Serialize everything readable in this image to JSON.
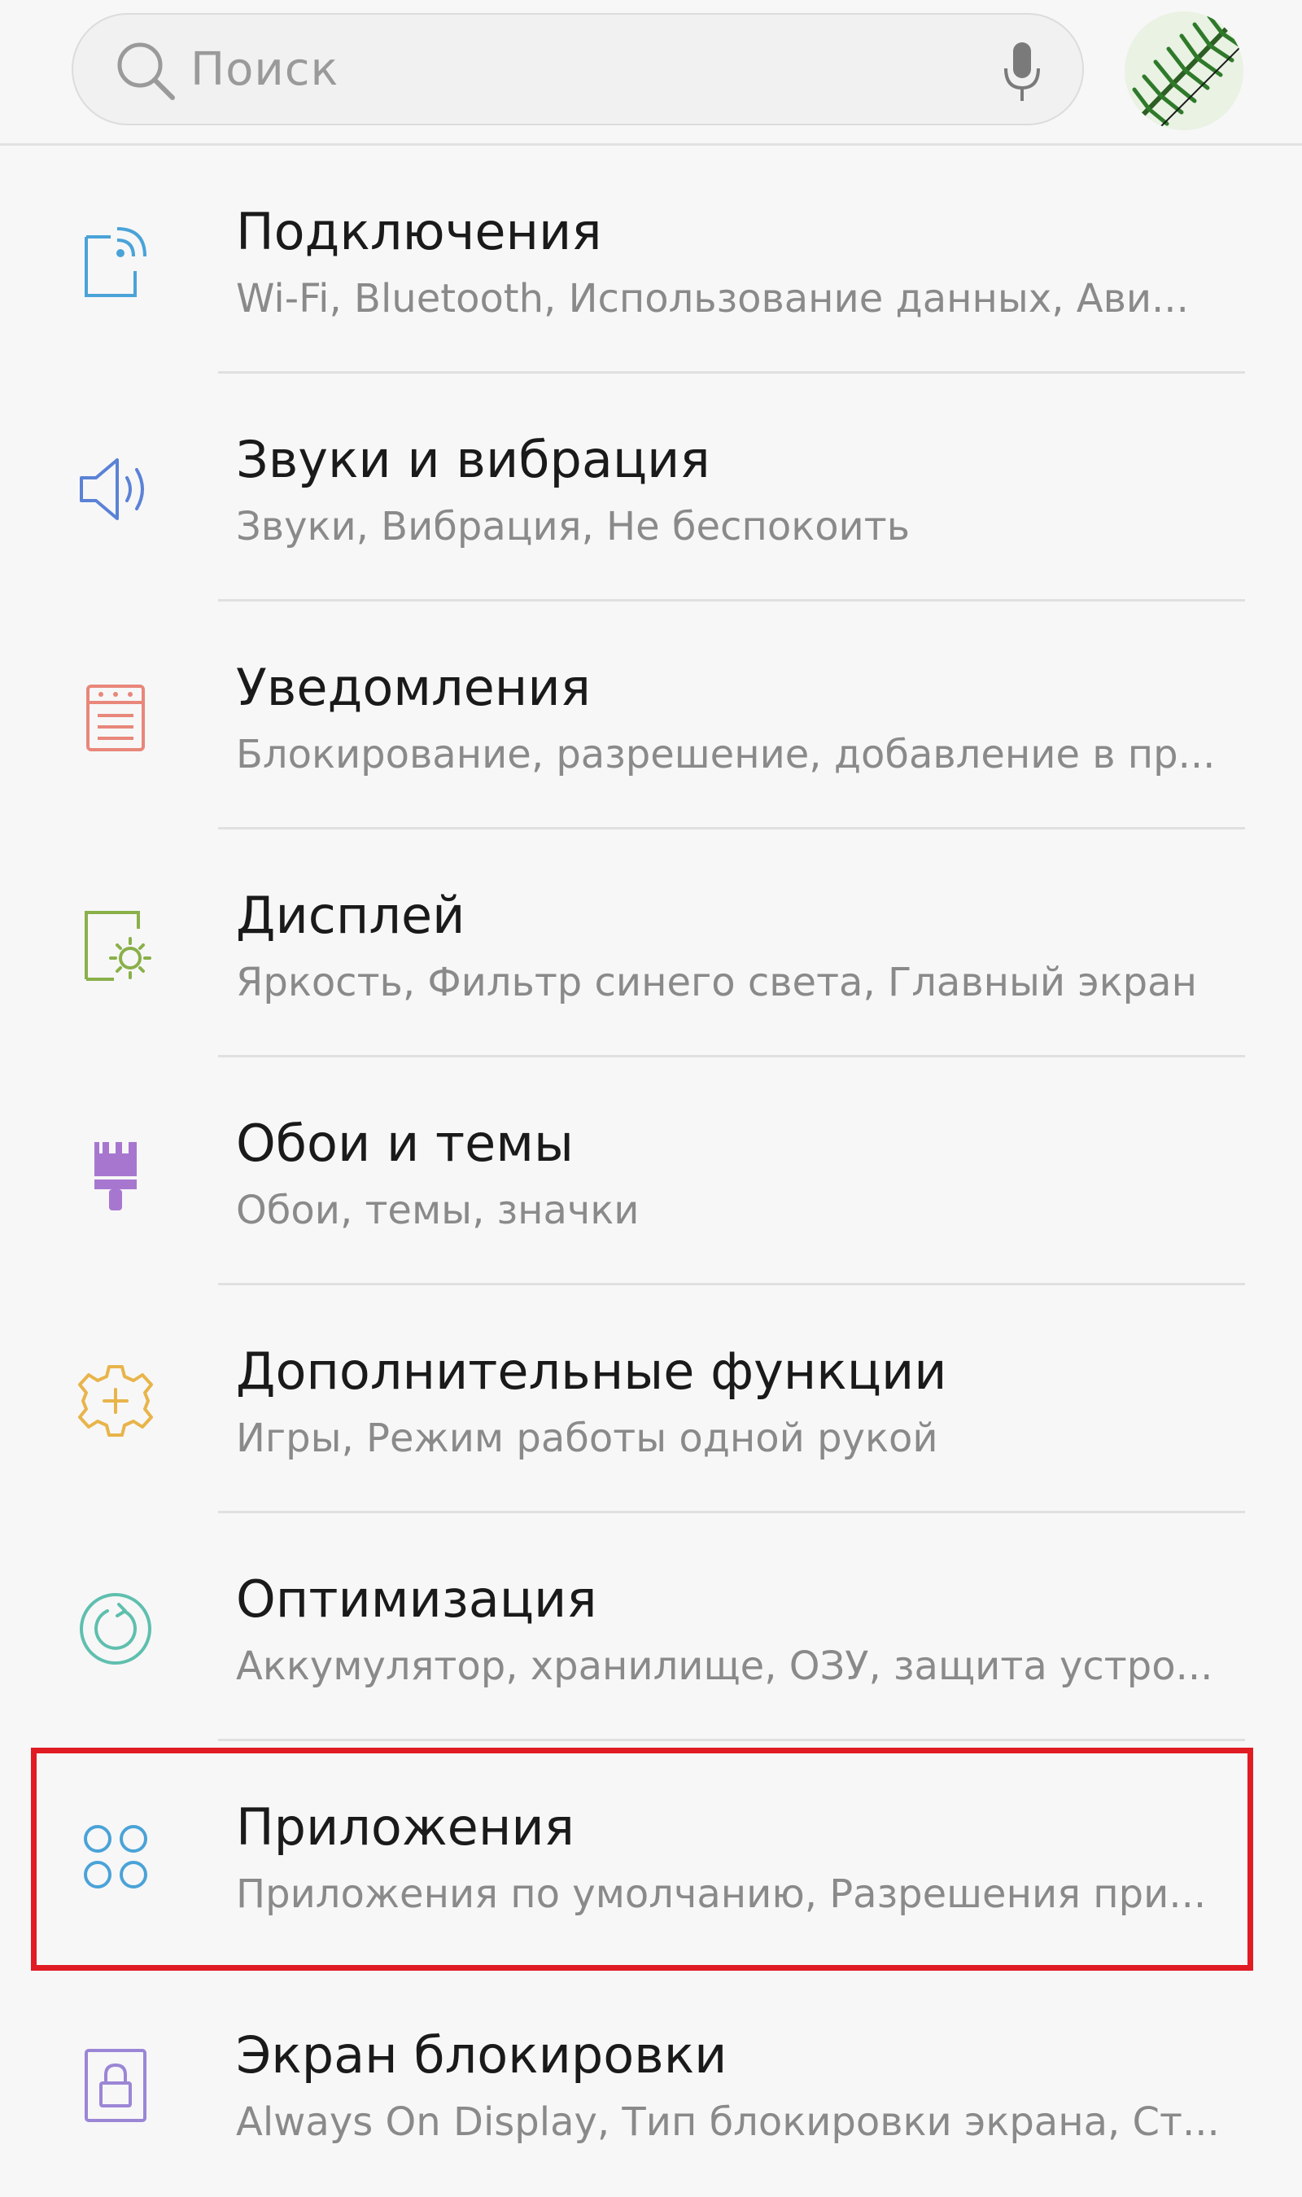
{
  "search": {
    "placeholder": "Поиск"
  },
  "icons": {
    "search": "search-icon",
    "mic": "microphone-icon",
    "avatar": "fern-leaf-avatar"
  },
  "settings": [
    {
      "title": "Подключения",
      "subtitle": "Wi-Fi, Bluetooth, Использование данных, Ави...",
      "icon": "connections-icon",
      "color": "#4aa3d8"
    },
    {
      "title": "Звуки и вибрация",
      "subtitle": "Звуки, Вибрация, Не беспокоить",
      "icon": "speaker-icon",
      "color": "#5b82d6"
    },
    {
      "title": "Уведомления",
      "subtitle": "Блокирование, разрешение, добавление в пр...",
      "icon": "notifications-icon",
      "color": "#e8877a"
    },
    {
      "title": "Дисплей",
      "subtitle": "Яркость, Фильтр синего света, Главный экран",
      "icon": "display-icon",
      "color": "#8ab04a"
    },
    {
      "title": "Обои и темы",
      "subtitle": "Обои, темы, значки",
      "icon": "paintbrush-icon",
      "color": "#a777d0"
    },
    {
      "title": "Дополнительные функции",
      "subtitle": "Игры, Режим работы одной рукой",
      "icon": "gear-plus-icon",
      "color": "#e8b44a"
    },
    {
      "title": "Оптимизация",
      "subtitle": "Аккумулятор, хранилище, ОЗУ, защита устро...",
      "icon": "optimization-icon",
      "color": "#5fbfae"
    },
    {
      "title": "Приложения",
      "subtitle": "Приложения по умолчанию, Разрешения при...",
      "icon": "apps-icon",
      "color": "#4aa3d8",
      "highlighted": true
    },
    {
      "title": "Экран блокировки",
      "subtitle": "Always On Display, Тип блокировки экрана, Ст...",
      "icon": "lock-screen-icon",
      "color": "#9b86d6"
    }
  ],
  "highlight_color": "#e01b24"
}
